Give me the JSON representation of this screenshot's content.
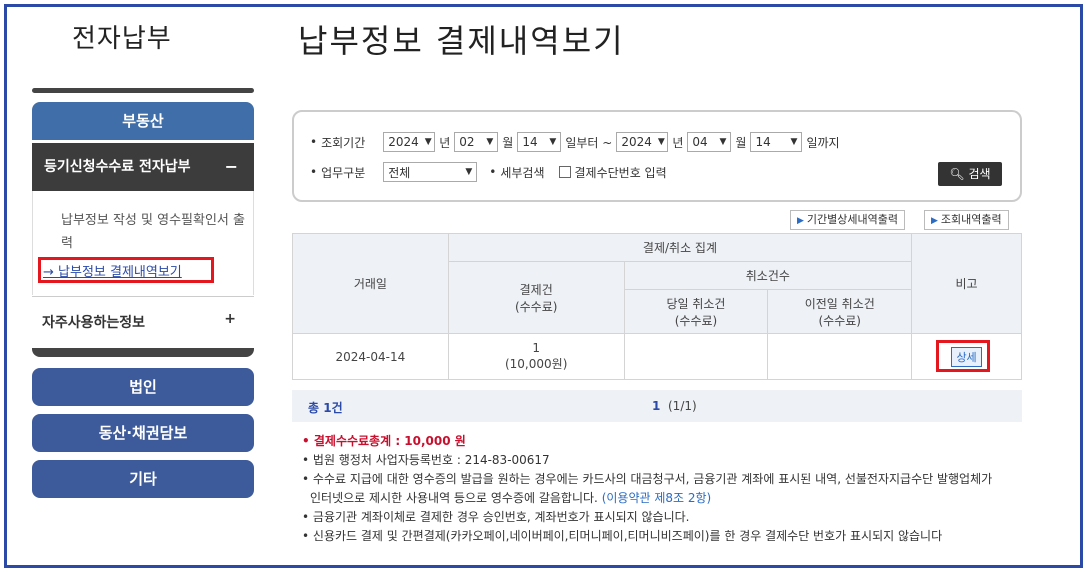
{
  "sidebar": {
    "title": "전자납부",
    "categories": [
      {
        "label": "부동산"
      },
      {
        "label": "등기신청수수료 전자납부",
        "toggle": "−"
      },
      {
        "label": "자주사용하는정보",
        "toggle": "+"
      },
      {
        "label": "법인"
      },
      {
        "label": "동산·채권담보"
      },
      {
        "label": "기타"
      }
    ],
    "sub_items": [
      {
        "label": "납부정보 작성 및 영수필확인서 출력"
      },
      {
        "label": "→ 납부정보 결제내역보기"
      }
    ]
  },
  "main": {
    "title": "납부정보 결제내역보기",
    "search": {
      "period_label": "조회기간",
      "start": {
        "year": "2024",
        "month": "02",
        "day": "14"
      },
      "end": {
        "year": "2024",
        "month": "04",
        "day": "14"
      },
      "unit_year": "년",
      "unit_month": "월",
      "from_text": "일부터 ~",
      "to_text": "일까지",
      "type_label": "업무구분",
      "type_value": "전체",
      "detail_label": "세부검색",
      "checkbox_label": "결제수단번호 입력",
      "search_button": "검색"
    },
    "buttons": {
      "period_detail": "기간별상세내역출력",
      "query_print": "조회내역출력"
    },
    "table": {
      "headers": {
        "date": "거래일",
        "summary": "결제/취소 집계",
        "payments": "결제건\n(수수료)",
        "cancels": "취소건수",
        "same_day": "당일 취소건\n(수수료)",
        "prev_day": "이전일 취소건\n(수수료)",
        "note": "비고"
      },
      "rows": [
        {
          "date": "2024-04-14",
          "payments": "1",
          "fee": "(10,000원)",
          "same_day": "",
          "prev_day": "",
          "detail": "상세"
        }
      ]
    },
    "footer": {
      "total": "총 1건",
      "page_current": "1",
      "page_info": "(1/1)"
    },
    "notes": [
      {
        "text": "결제수수료총계 : 10,000 원"
      },
      {
        "text": "법원 행정처 사업자등록번호 : 214-83-00617"
      },
      {
        "text": "수수료 지급에 대한 영수증의 발급을 원하는 경우에는 카드사의 대금청구서, 금융기관 계좌에 표시된 내역, 선불전자지급수단 발행업체가"
      },
      {
        "text": "인터넷으로 제시한 사용내역 등으로 영수증에 갈음합니다.",
        "link": "(이용약관 제8조 2항)"
      },
      {
        "text": "금융기관 계좌이체로 결제한 경우 승인번호, 계좌번호가 표시되지 않습니다."
      },
      {
        "text": "신용카드 결제 및 간편결제(카카오페이,네이버페이,티머니페이,티머니비즈페이)를 한 경우 결제수단 번호가 표시되지 않습니다"
      }
    ]
  },
  "colors": {
    "accent": "#2b4aa8",
    "category": "#3f6ea8",
    "highlight": "#e4161e",
    "dark": "#3c3c3c"
  }
}
